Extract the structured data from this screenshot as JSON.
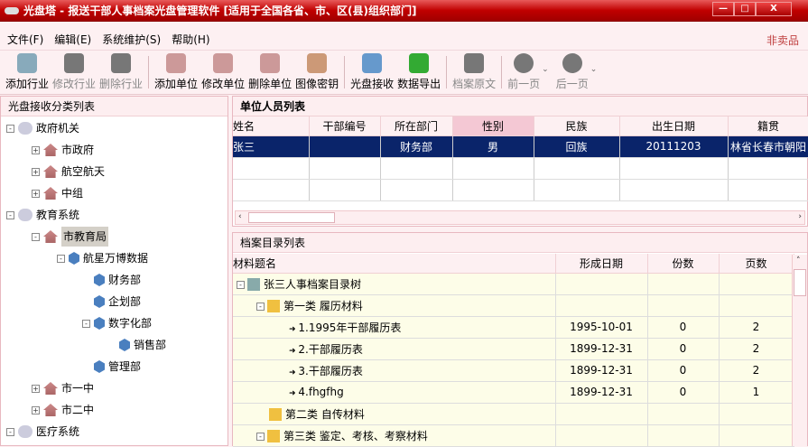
{
  "window": {
    "title": "光盘塔 - 报送干部人事档案光盘管理软件 [适用于全国各省、市、区(县)组织部门]",
    "min": "—",
    "max": "□",
    "close": "X"
  },
  "menu": [
    "文件(F)",
    "编辑(E)",
    "系统维护(S)",
    "帮助(H)"
  ],
  "not_for_sale": "非卖品",
  "toolbar": [
    {
      "label": "添加行业",
      "icon": "add-industry-icon",
      "enabled": true,
      "color": "#8ab"
    },
    {
      "label": "修改行业",
      "icon": "edit-industry-icon",
      "enabled": false,
      "color": "#777"
    },
    {
      "label": "删除行业",
      "icon": "delete-industry-icon",
      "enabled": false,
      "color": "#777"
    },
    {
      "sep": true
    },
    {
      "label": "添加单位",
      "icon": "add-unit-icon",
      "enabled": true,
      "color": "#c99"
    },
    {
      "label": "修改单位",
      "icon": "edit-unit-icon",
      "enabled": true,
      "color": "#c99"
    },
    {
      "label": "删除单位",
      "icon": "delete-unit-icon",
      "enabled": true,
      "color": "#c99"
    },
    {
      "label": "图像密钥",
      "icon": "image-key-icon",
      "enabled": true,
      "color": "#c97"
    },
    {
      "sep": true
    },
    {
      "label": "光盘接收",
      "icon": "disc-receive-icon",
      "enabled": true,
      "color": "#69c"
    },
    {
      "label": "数据导出",
      "icon": "data-export-icon",
      "enabled": true,
      "color": "#3a3"
    },
    {
      "sep": true
    },
    {
      "label": "档案原文",
      "icon": "archive-original-icon",
      "enabled": false,
      "color": "#777"
    },
    {
      "sep": true
    },
    {
      "label": "前一页",
      "icon": "previous-page-icon",
      "enabled": false,
      "color": "#777",
      "dropdown": true
    },
    {
      "label": "后一页",
      "icon": "next-page-icon",
      "enabled": false,
      "color": "#777",
      "dropdown": true
    }
  ],
  "left_panel": {
    "title": "光盘接收分类列表",
    "tree": [
      {
        "label": "政府机关",
        "level": 0,
        "icon": "cloud",
        "exp": "-"
      },
      {
        "label": "市政府",
        "level": 1,
        "icon": "house",
        "exp": "+"
      },
      {
        "label": "航空航天",
        "level": 1,
        "icon": "house",
        "exp": "+"
      },
      {
        "label": "中组",
        "level": 1,
        "icon": "house",
        "exp": "+"
      },
      {
        "label": "教育系统",
        "level": 0,
        "icon": "cloud",
        "exp": "-"
      },
      {
        "label": "市教育局",
        "level": 1,
        "icon": "house",
        "exp": "-",
        "selected": true
      },
      {
        "label": "航星万博数据",
        "level": 2,
        "icon": "cube",
        "exp": "-"
      },
      {
        "label": "财务部",
        "level": 3,
        "icon": "cube"
      },
      {
        "label": "企划部",
        "level": 3,
        "icon": "cube"
      },
      {
        "label": "数字化部",
        "level": 3,
        "icon": "cube",
        "exp": "-"
      },
      {
        "label": "销售部",
        "level": 4,
        "icon": "cube"
      },
      {
        "label": "管理部",
        "level": 3,
        "icon": "cube"
      },
      {
        "label": "市一中",
        "level": 1,
        "icon": "house",
        "exp": "+"
      },
      {
        "label": "市二中",
        "level": 1,
        "icon": "house",
        "exp": "+"
      },
      {
        "label": "医疗系统",
        "level": 0,
        "icon": "cloud",
        "exp": "-"
      }
    ]
  },
  "personnel": {
    "title": "单位人员列表",
    "columns": [
      "姓名",
      "干部编号",
      "所在部门",
      "性别",
      "民族",
      "出生日期",
      "籍贯"
    ],
    "rows": [
      [
        "张三",
        "",
        "财务部",
        "男",
        "回族",
        "20111203",
        "林省长春市朝阳"
      ]
    ],
    "empty_rows": 2
  },
  "archive": {
    "title": "档案目录列表",
    "columns": [
      "材料题名",
      "形成日期",
      "份数",
      "页数"
    ],
    "rows": [
      {
        "name": "张三人事档案目录树",
        "type": "person",
        "level": 0,
        "exp": "-",
        "date": "",
        "copies": "",
        "pages": ""
      },
      {
        "name": "第一类 履历材料",
        "type": "folder",
        "level": 1,
        "exp": "-",
        "date": "",
        "copies": "",
        "pages": ""
      },
      {
        "name": "1.1995年干部履历表",
        "type": "item",
        "level": 2,
        "date": "1995-10-01",
        "copies": "0",
        "pages": "2"
      },
      {
        "name": "2.干部履历表",
        "type": "item",
        "level": 2,
        "date": "1899-12-31",
        "copies": "0",
        "pages": "2"
      },
      {
        "name": "3.干部履历表",
        "type": "item",
        "level": 2,
        "date": "1899-12-31",
        "copies": "0",
        "pages": "2"
      },
      {
        "name": "4.fhgfhg",
        "type": "item",
        "level": 2,
        "date": "1899-12-31",
        "copies": "0",
        "pages": "1"
      },
      {
        "name": "第二类 自传材料",
        "type": "folder",
        "level": 1,
        "date": "",
        "copies": "",
        "pages": ""
      },
      {
        "name": "第三类 鉴定、考核、考察材料",
        "type": "folder",
        "level": 1,
        "exp": "-",
        "date": "",
        "copies": "",
        "pages": ""
      }
    ]
  }
}
